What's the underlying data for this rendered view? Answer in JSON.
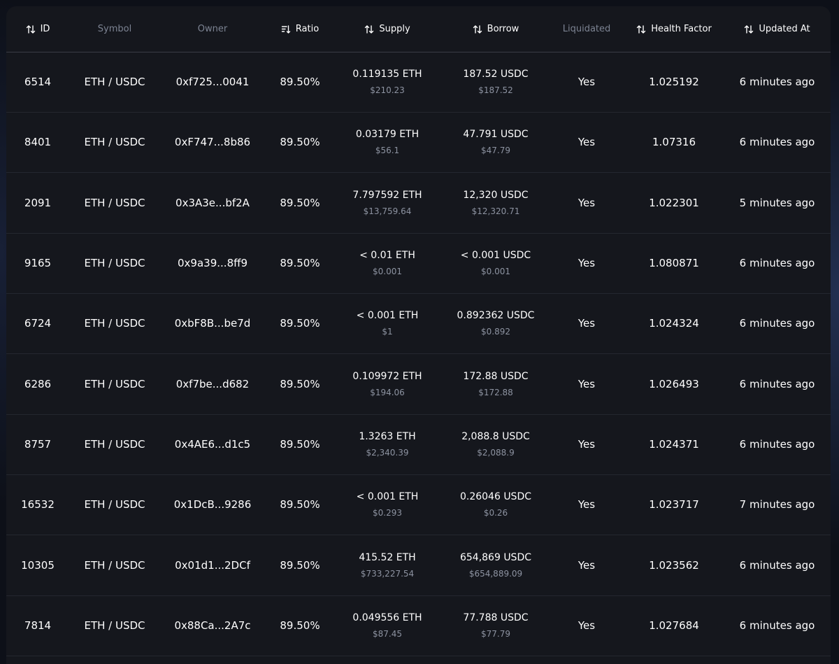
{
  "table": {
    "columns": [
      {
        "key": "id",
        "label": "ID",
        "sortable": true,
        "icon": "sort-arrows-icon"
      },
      {
        "key": "symbol",
        "label": "Symbol",
        "sortable": false
      },
      {
        "key": "owner",
        "label": "Owner",
        "sortable": false
      },
      {
        "key": "ratio",
        "label": "Ratio",
        "sortable": true,
        "icon": "sort-descending-icon"
      },
      {
        "key": "supply",
        "label": "Supply",
        "sortable": true,
        "icon": "sort-arrows-icon"
      },
      {
        "key": "borrow",
        "label": "Borrow",
        "sortable": true,
        "icon": "sort-arrows-icon"
      },
      {
        "key": "liquidated",
        "label": "Liquidated",
        "sortable": false
      },
      {
        "key": "health_factor",
        "label": "Health Factor",
        "sortable": true,
        "icon": "sort-arrows-icon"
      },
      {
        "key": "updated_at",
        "label": "Updated At",
        "sortable": true,
        "icon": "sort-arrows-icon"
      }
    ],
    "rows": [
      {
        "id": "6514",
        "symbol": "ETH / USDC",
        "owner": "0xf725...0041",
        "ratio": "89.50%",
        "supply": "0.119135 ETH",
        "supply_usd": "$210.23",
        "borrow": "187.52 USDC",
        "borrow_usd": "$187.52",
        "liquidated": "Yes",
        "health_factor": "1.025192",
        "updated_at": "6 minutes ago"
      },
      {
        "id": "8401",
        "symbol": "ETH / USDC",
        "owner": "0xF747...8b86",
        "ratio": "89.50%",
        "supply": "0.03179 ETH",
        "supply_usd": "$56.1",
        "borrow": "47.791 USDC",
        "borrow_usd": "$47.79",
        "liquidated": "Yes",
        "health_factor": "1.07316",
        "updated_at": "6 minutes ago"
      },
      {
        "id": "2091",
        "symbol": "ETH / USDC",
        "owner": "0x3A3e...bf2A",
        "ratio": "89.50%",
        "supply": "7.797592 ETH",
        "supply_usd": "$13,759.64",
        "borrow": "12,320 USDC",
        "borrow_usd": "$12,320.71",
        "liquidated": "Yes",
        "health_factor": "1.022301",
        "updated_at": "5 minutes ago"
      },
      {
        "id": "9165",
        "symbol": "ETH / USDC",
        "owner": "0x9a39...8ff9",
        "ratio": "89.50%",
        "supply": "< 0.01 ETH",
        "supply_usd": "$0.001",
        "borrow": "< 0.001 USDC",
        "borrow_usd": "$0.001",
        "liquidated": "Yes",
        "health_factor": "1.080871",
        "updated_at": "6 minutes ago"
      },
      {
        "id": "6724",
        "symbol": "ETH / USDC",
        "owner": "0xbF8B...be7d",
        "ratio": "89.50%",
        "supply": "< 0.001 ETH",
        "supply_usd": "$1",
        "borrow": "0.892362 USDC",
        "borrow_usd": "$0.892",
        "liquidated": "Yes",
        "health_factor": "1.024324",
        "updated_at": "6 minutes ago"
      },
      {
        "id": "6286",
        "symbol": "ETH / USDC",
        "owner": "0xf7be...d682",
        "ratio": "89.50%",
        "supply": "0.109972 ETH",
        "supply_usd": "$194.06",
        "borrow": "172.88 USDC",
        "borrow_usd": "$172.88",
        "liquidated": "Yes",
        "health_factor": "1.026493",
        "updated_at": "6 minutes ago"
      },
      {
        "id": "8757",
        "symbol": "ETH / USDC",
        "owner": "0x4AE6...d1c5",
        "ratio": "89.50%",
        "supply": "1.3263 ETH",
        "supply_usd": "$2,340.39",
        "borrow": "2,088.8 USDC",
        "borrow_usd": "$2,088.9",
        "liquidated": "Yes",
        "health_factor": "1.024371",
        "updated_at": "6 minutes ago"
      },
      {
        "id": "16532",
        "symbol": "ETH / USDC",
        "owner": "0x1DcB...9286",
        "ratio": "89.50%",
        "supply": "< 0.001 ETH",
        "supply_usd": "$0.293",
        "borrow": "0.26046 USDC",
        "borrow_usd": "$0.26",
        "liquidated": "Yes",
        "health_factor": "1.023717",
        "updated_at": "7 minutes ago"
      },
      {
        "id": "10305",
        "symbol": "ETH / USDC",
        "owner": "0x01d1...2DCf",
        "ratio": "89.50%",
        "supply": "415.52 ETH",
        "supply_usd": "$733,227.54",
        "borrow": "654,869 USDC",
        "borrow_usd": "$654,889.09",
        "liquidated": "Yes",
        "health_factor": "1.023562",
        "updated_at": "6 minutes ago"
      },
      {
        "id": "7814",
        "symbol": "ETH / USDC",
        "owner": "0x88Ca...2A7c",
        "ratio": "89.50%",
        "supply": "0.049556 ETH",
        "supply_usd": "$87.45",
        "borrow": "77.788 USDC",
        "borrow_usd": "$77.79",
        "liquidated": "Yes",
        "health_factor": "1.027684",
        "updated_at": "6 minutes ago"
      }
    ]
  },
  "colors": {
    "page_background": "#0d1018",
    "panel_background": "#15171d",
    "text_primary": "#ffffff",
    "text_muted": "#7c8392",
    "text_secondary": "#8d93a1",
    "header_divider": "#3a3d46",
    "row_divider": "#24272f"
  }
}
